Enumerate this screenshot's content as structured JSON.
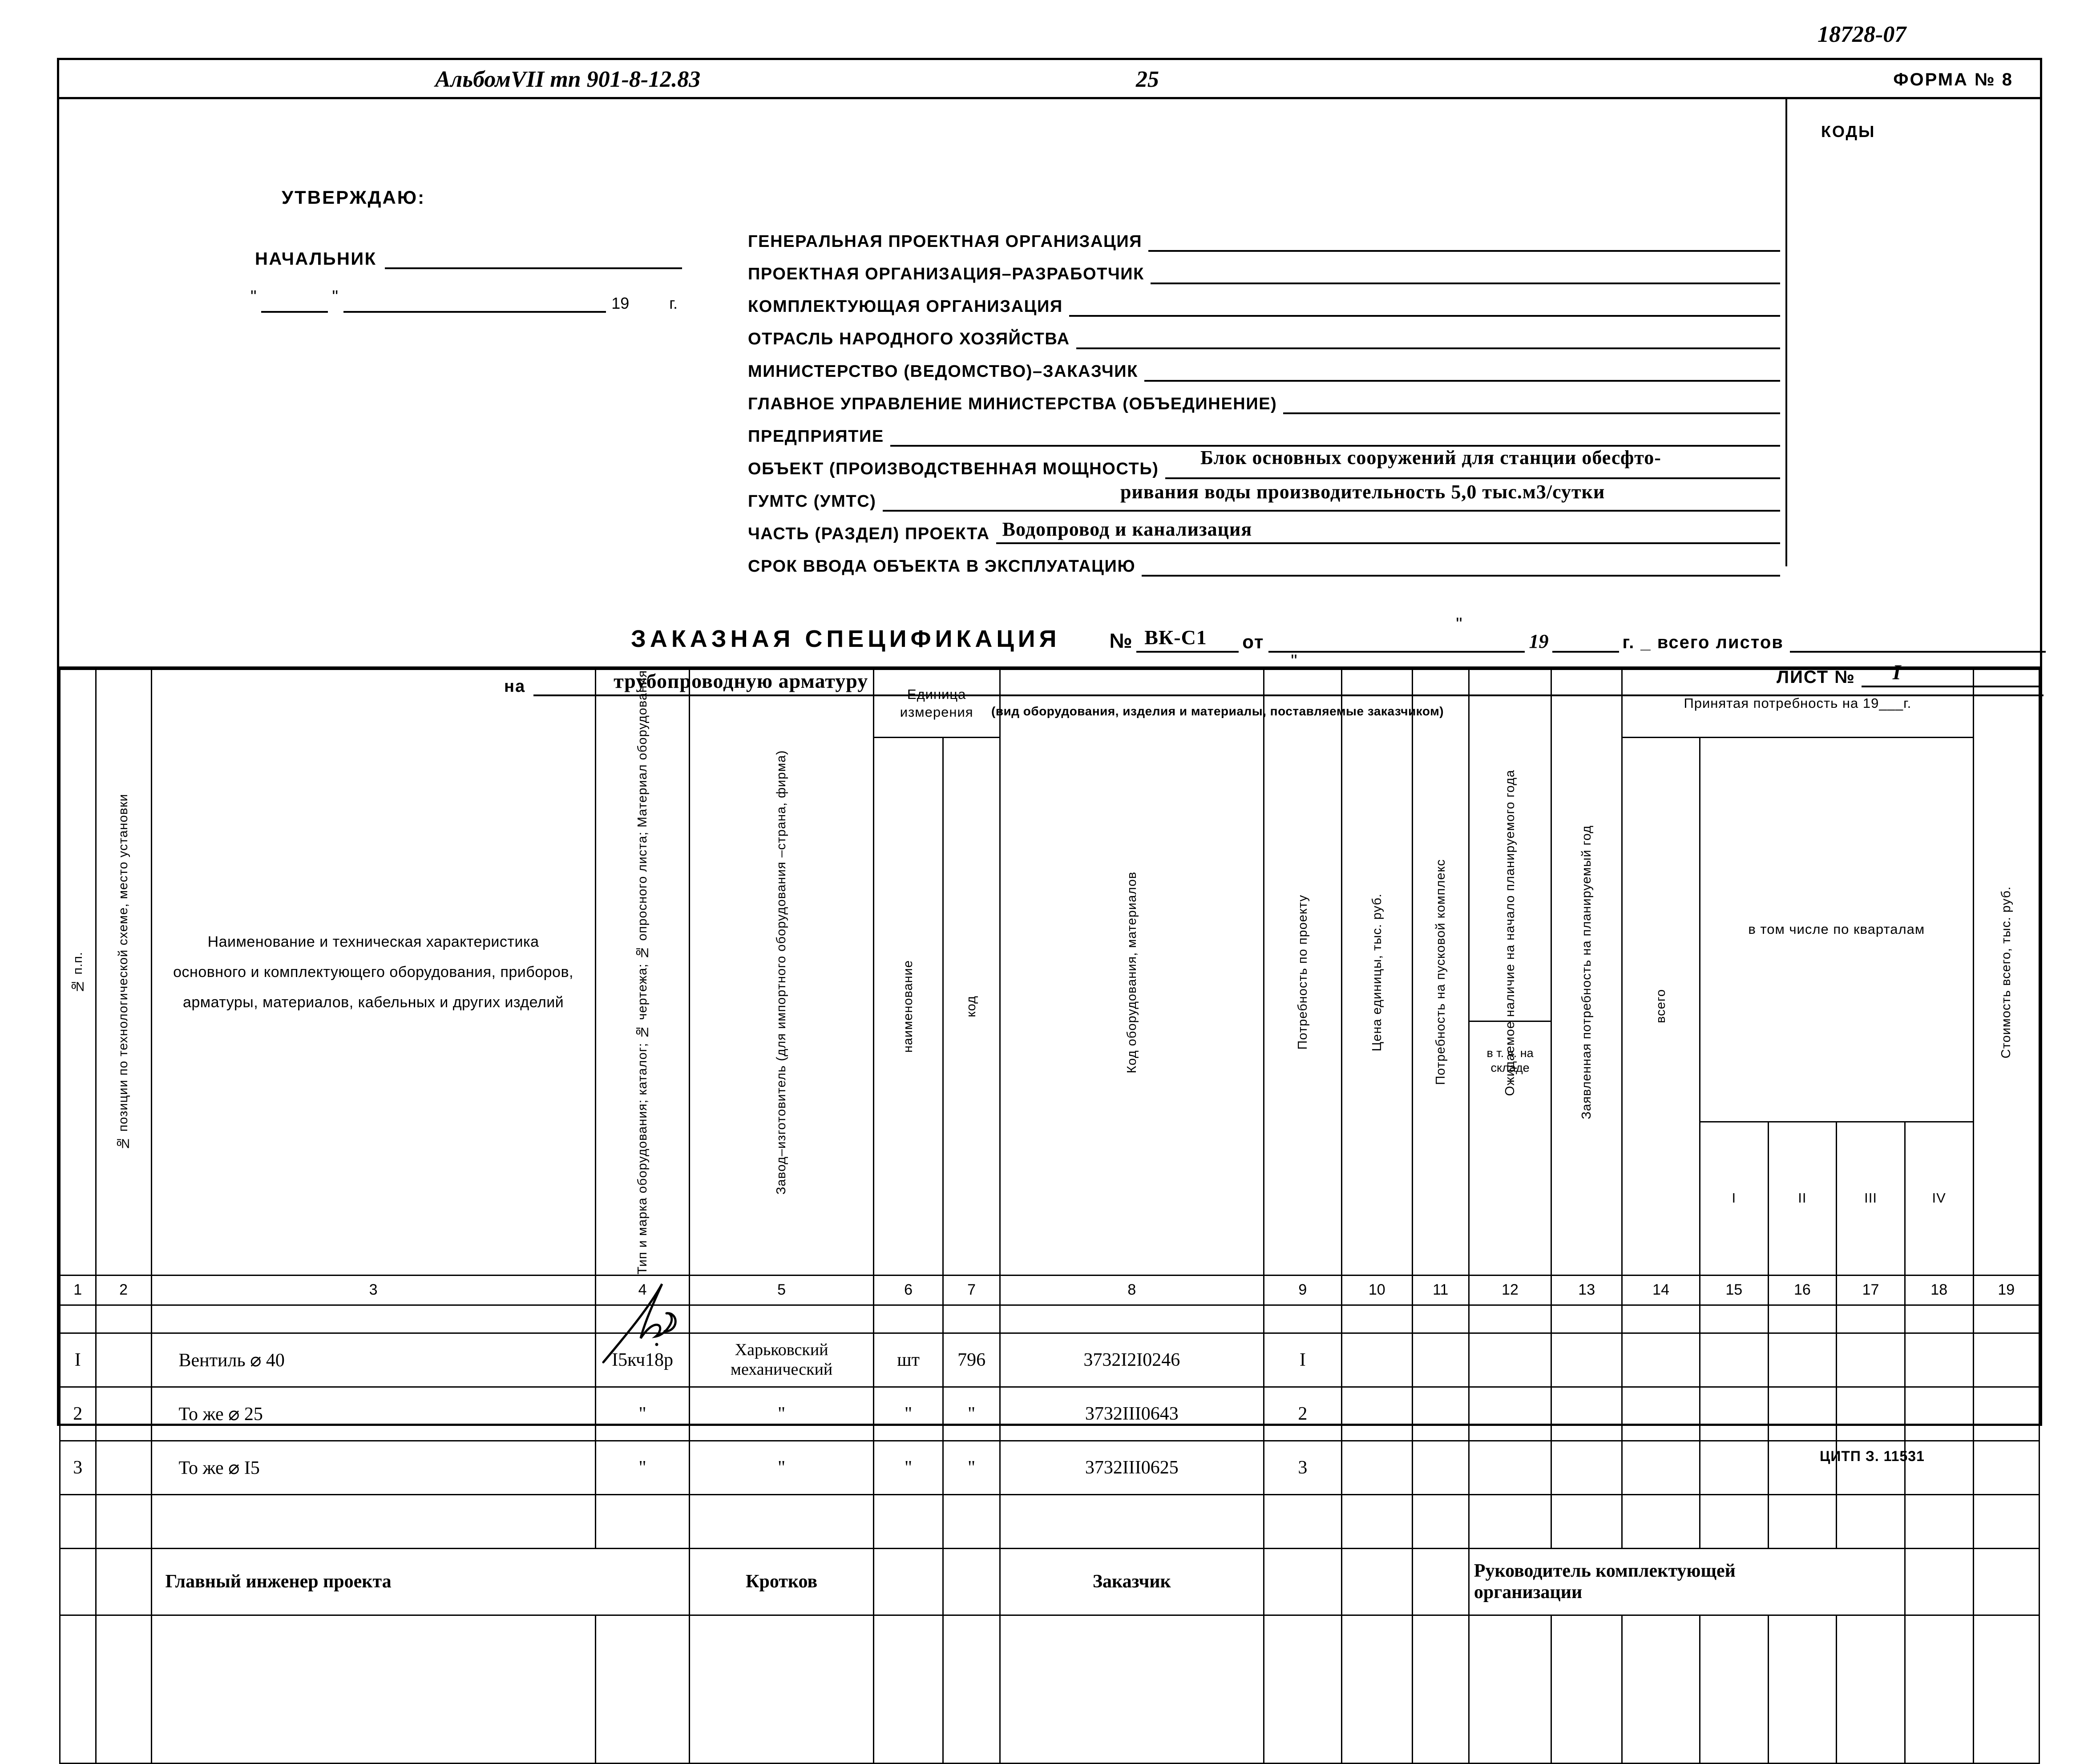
{
  "document": {
    "handwritten_number": "18728-07",
    "album": "АльбомVII  тп 901-8-12.83",
    "page_number": "25",
    "form_number": "ФОРМА № 8",
    "codes_label": "КОДЫ",
    "footer_code": "ЦИТП З. 11531"
  },
  "approval": {
    "title": "УТВЕРЖДАЮ:",
    "chief_label": "НАЧАЛЬНИК",
    "quote": "\"",
    "year_prefix": "19",
    "year_suffix": "г."
  },
  "fields": [
    {
      "label": "ГЕНЕРАЛЬНАЯ ПРОЕКТНАЯ ОРГАНИЗАЦИЯ",
      "value": ""
    },
    {
      "label": "ПРОЕКТНАЯ ОРГАНИЗАЦИЯ–РАЗРАБОТЧИК",
      "value": ""
    },
    {
      "label": "КОМПЛЕКТУЮЩАЯ ОРГАНИЗАЦИЯ",
      "value": ""
    },
    {
      "label": "ОТРАСЛЬ НАРОДНОГО ХОЗЯЙСТВА",
      "value": ""
    },
    {
      "label": "МИНИСТЕРСТВО (ВЕДОМСТВО)–ЗАКАЗЧИК",
      "value": ""
    },
    {
      "label": "ГЛАВНОЕ УПРАВЛЕНИЕ МИНИСТЕРСТВА (ОБЪЕДИНЕНИЕ)",
      "value": ""
    },
    {
      "label": "ПРЕДПРИЯТИЕ",
      "value": ""
    },
    {
      "label": "ОБЪЕКТ (ПРОИЗВОДСТВЕННАЯ МОЩНОСТЬ)",
      "value": ""
    },
    {
      "label": "ГУМТС (УМТС)",
      "value": ""
    },
    {
      "label": "ЧАСТЬ (РАЗДЕЛ) ПРОЕКТА",
      "value": "Водопровод и канализация"
    },
    {
      "label": "СРОК ВВОДА ОБЪЕКТА В ЭКСПЛУАТАЦИЮ",
      "value": ""
    }
  ],
  "object_value": {
    "line1": "Блок основных сооружений для станции обесфто-",
    "line2": "ривания воды производительность 5,0 тыс.м3/сутки"
  },
  "spec": {
    "title": "ЗАКАЗНАЯ СПЕЦИФИКАЦИЯ",
    "num_label": "№",
    "num_value": "ВК-С1",
    "from_label": "от",
    "year_prefix": "19",
    "year_suffix": "г. _ всего листов",
    "on_label": "на",
    "on_value": "трубопроводную арматуру",
    "caption": "(вид оборудования, изделия и материалы, поставляемые заказчиком)",
    "sheet_label": "ЛИСТ №",
    "sheet_value": "I"
  },
  "table": {
    "group_headers": {
      "unit": "Единица\nизмерения",
      "accepted_need": "Принятая потребность на 19___г.",
      "by_quarters": "в том числе по кварталам"
    },
    "columns": [
      {
        "num": "1",
        "title": "№ п.п."
      },
      {
        "num": "2",
        "title": "№ позиции по технологической схеме, место установки"
      },
      {
        "num": "3",
        "title": "Наименование и техническая характеристика основного и комплектующего оборудования, приборов, арматуры, материалов, кабельных и других изделий"
      },
      {
        "num": "4",
        "title": "Тип и марка оборудования; каталог; № чертежа; № опросного листа; Материал оборудования"
      },
      {
        "num": "5",
        "title": "Завод–изготовитель (для импортного оборудования –страна, фирма)"
      },
      {
        "num": "6",
        "title": "наименование"
      },
      {
        "num": "7",
        "title": "код"
      },
      {
        "num": "8",
        "title": "Код оборудования, материалов"
      },
      {
        "num": "9",
        "title": "Потребность по проекту"
      },
      {
        "num": "10",
        "title": "Цена единицы, тыс. руб."
      },
      {
        "num": "11",
        "title": "Потребность на пусковой комплекс"
      },
      {
        "num": "12",
        "title": "Ожидаемое наличие на начало планируемого года",
        "sub": "в т. ч. на складе"
      },
      {
        "num": "13",
        "title": "Заявленная потребность на планируемый год"
      },
      {
        "num": "14",
        "title": "всего"
      },
      {
        "num": "15",
        "title": "I"
      },
      {
        "num": "16",
        "title": "II"
      },
      {
        "num": "17",
        "title": "III"
      },
      {
        "num": "18",
        "title": "IV"
      },
      {
        "num": "19",
        "title": "Стоимость всего, тыс. руб."
      }
    ],
    "rows": [
      {
        "c1": "I",
        "c2": "",
        "c3": "Вентиль ⌀ 40",
        "c4": "I5кч18р",
        "c5": "Харьковский механический",
        "c6": "шт",
        "c7": "796",
        "c8": "3732I2I0246",
        "c9": "I",
        "c10": "",
        "c11": "",
        "c12": "",
        "c13": "",
        "c14": "",
        "c15": "",
        "c16": "",
        "c17": "",
        "c18": "",
        "c19": ""
      },
      {
        "c1": "2",
        "c2": "",
        "c3": "То же ⌀ 25",
        "c4": "\"",
        "c5": "\"",
        "c6": "\"",
        "c7": "\"",
        "c8": "3732III0643",
        "c9": "2",
        "c10": "",
        "c11": "",
        "c12": "",
        "c13": "",
        "c14": "",
        "c15": "",
        "c16": "",
        "c17": "",
        "c18": "",
        "c19": ""
      },
      {
        "c1": "3",
        "c2": "",
        "c3": "То же ⌀ I5",
        "c4": "\"",
        "c5": "\"",
        "c6": "\"",
        "c7": "\"",
        "c8": "3732III0625",
        "c9": "3",
        "c10": "",
        "c11": "",
        "c12": "",
        "c13": "",
        "c14": "",
        "c15": "",
        "c16": "",
        "c17": "",
        "c18": "",
        "c19": ""
      }
    ],
    "signatures": {
      "engineer": "Главный инженер проекта",
      "engineer_name": "Кротков",
      "customer": "Заказчик",
      "supplier_line1": "Руководитель комплектующей",
      "supplier_line2": "организации"
    }
  }
}
